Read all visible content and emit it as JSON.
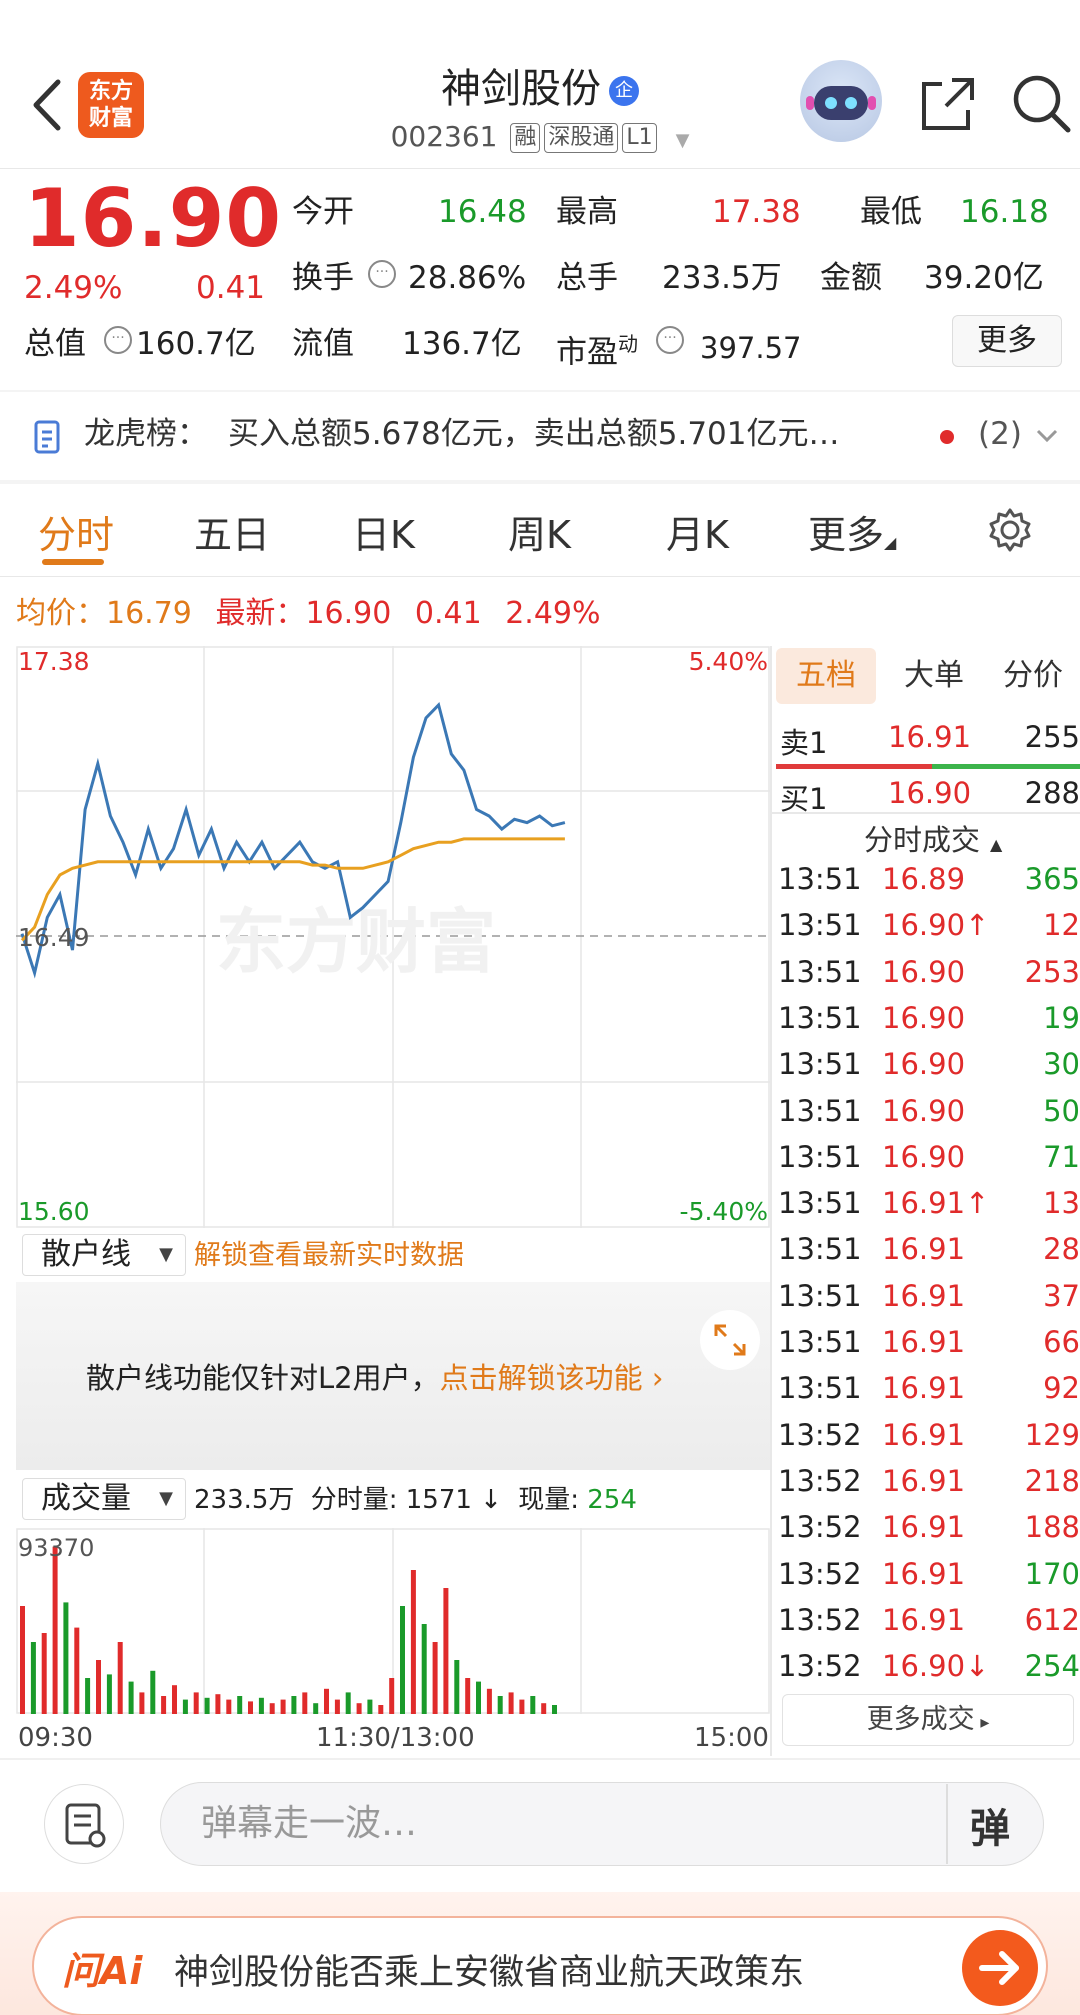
{
  "header": {
    "logo_text": "东方\n财富",
    "logo_l1": "东方",
    "logo_l2": "财富",
    "title": "神剑股份",
    "title_badge": "企",
    "code": "002361",
    "tags": [
      "融",
      "深股通",
      "L1"
    ]
  },
  "quote": {
    "price": "16.90",
    "change_pct": "2.49%",
    "change": "0.41",
    "open_label": "今开",
    "open": "16.48",
    "high_label": "最高",
    "high": "17.38",
    "low_label": "最低",
    "low": "16.18",
    "turnover_label": "换手",
    "turnover": "28.86%",
    "vol_label": "总手",
    "vol": "233.5万",
    "amount_label": "金额",
    "amount": "39.20亿",
    "mcap_label": "总值",
    "mcap": "160.7亿",
    "float_label": "流值",
    "float": "136.7亿",
    "pe_label": "市盈",
    "pe_sup": "动",
    "pe": "397.57",
    "more_label": "更多"
  },
  "lhb": {
    "label": "龙虎榜：",
    "text": "买入总额5.678亿元，卖出总额5.701亿元…",
    "count": "(2)"
  },
  "tabs": [
    "分时",
    "五日",
    "日K",
    "周K",
    "月K",
    "更多"
  ],
  "avg": {
    "avg_label": "均价：",
    "avg": "16.79",
    "latest_label": "最新：",
    "latest": "16.90",
    "chg": "0.41",
    "pct": "2.49%"
  },
  "chart_data": {
    "type": "line",
    "y_top_label": "17.38",
    "y_base_label": "16.49",
    "y_bottom_label": "15.60",
    "pct_top_label": "5.40%",
    "pct_bottom_label": "-5.40%",
    "ylim": [
      15.6,
      17.38
    ],
    "base": 16.49,
    "x_tick_labels": [
      "09:30",
      "11:30/13:00",
      "15:00"
    ],
    "watermark": "东方财富",
    "series": [
      {
        "values": [
          16.5,
          16.38,
          16.55,
          16.62,
          16.45,
          16.88,
          17.02,
          16.86,
          16.78,
          16.68,
          16.82,
          16.7,
          16.76,
          16.88,
          16.74,
          16.82,
          16.7,
          16.78,
          16.72,
          16.78,
          16.7,
          16.74,
          16.78,
          16.72,
          16.7,
          16.72,
          16.55,
          16.58,
          16.62,
          16.66,
          16.84,
          17.04,
          17.16,
          17.2,
          17.05,
          17.0,
          16.88,
          16.86,
          16.82,
          16.85,
          16.84,
          16.86,
          16.83,
          16.84
        ]
      },
      {
        "values": [
          16.48,
          16.52,
          16.62,
          16.68,
          16.7,
          16.71,
          16.72,
          16.72,
          16.72,
          16.72,
          16.72,
          16.72,
          16.72,
          16.72,
          16.72,
          16.72,
          16.72,
          16.72,
          16.72,
          16.72,
          16.72,
          16.72,
          16.72,
          16.71,
          16.71,
          16.7,
          16.7,
          16.7,
          16.71,
          16.72,
          16.74,
          16.76,
          16.77,
          16.78,
          16.78,
          16.79,
          16.79,
          16.79,
          16.79,
          16.79,
          16.79,
          16.79,
          16.79,
          16.79
        ]
      }
    ],
    "volume": {
      "max_label": "93370",
      "max": 93370,
      "values": [
        60,
        40,
        45,
        93,
        62,
        48,
        20,
        30,
        22,
        40,
        18,
        12,
        24,
        10,
        16,
        8,
        12,
        9,
        11,
        8,
        10,
        7,
        9,
        6,
        8,
        10,
        12,
        6,
        14,
        8,
        12,
        6,
        8,
        5,
        20,
        60,
        80,
        50,
        40,
        70,
        30,
        20,
        18,
        14,
        10,
        12,
        8,
        10,
        6,
        5
      ],
      "up": [
        1,
        0,
        1,
        1,
        0,
        1,
        0,
        1,
        0,
        1,
        0,
        1,
        0,
        1,
        1,
        0,
        1,
        0,
        1,
        1,
        0,
        1,
        0,
        1,
        1,
        0,
        1,
        0,
        1,
        1,
        0,
        1,
        0,
        1,
        1,
        0,
        1,
        0,
        1,
        1,
        0,
        1,
        0,
        1,
        0,
        1,
        1,
        0,
        1,
        0
      ]
    }
  },
  "orderbook": {
    "tabs": [
      "五档",
      "大单",
      "分价"
    ],
    "sell1": {
      "label": "卖1",
      "price": "16.91",
      "vol": "255"
    },
    "buy1": {
      "label": "买1",
      "price": "16.90",
      "vol": "288"
    },
    "ticks_title": "分时成交",
    "ticks": [
      {
        "t": "13:51",
        "p": "16.89",
        "v": "365",
        "vc": "green"
      },
      {
        "t": "13:51",
        "p": "16.90↑",
        "v": "12",
        "vc": "red"
      },
      {
        "t": "13:51",
        "p": "16.90",
        "v": "253",
        "vc": "red"
      },
      {
        "t": "13:51",
        "p": "16.90",
        "v": "19",
        "vc": "green"
      },
      {
        "t": "13:51",
        "p": "16.90",
        "v": "30",
        "vc": "green"
      },
      {
        "t": "13:51",
        "p": "16.90",
        "v": "50",
        "vc": "green"
      },
      {
        "t": "13:51",
        "p": "16.90",
        "v": "71",
        "vc": "green"
      },
      {
        "t": "13:51",
        "p": "16.91↑",
        "v": "13",
        "vc": "red"
      },
      {
        "t": "13:51",
        "p": "16.91",
        "v": "28",
        "vc": "red"
      },
      {
        "t": "13:51",
        "p": "16.91",
        "v": "37",
        "vc": "red"
      },
      {
        "t": "13:51",
        "p": "16.91",
        "v": "66",
        "vc": "red"
      },
      {
        "t": "13:51",
        "p": "16.91",
        "v": "92",
        "vc": "red"
      },
      {
        "t": "13:52",
        "p": "16.91",
        "v": "129",
        "vc": "red"
      },
      {
        "t": "13:52",
        "p": "16.91",
        "v": "218",
        "vc": "red"
      },
      {
        "t": "13:52",
        "p": "16.91",
        "v": "188",
        "vc": "red"
      },
      {
        "t": "13:52",
        "p": "16.91",
        "v": "170",
        "vc": "green"
      },
      {
        "t": "13:52",
        "p": "16.91",
        "v": "612",
        "vc": "red"
      },
      {
        "t": "13:52",
        "p": "16.90↓",
        "v": "254",
        "vc": "green"
      }
    ],
    "more_ticks": "更多成交"
  },
  "retail": {
    "select": "散户线",
    "unlock_link": "解锁查看最新实时数据",
    "notice": "散户线功能仅针对L2用户，",
    "notice_link": "点击解锁该功能"
  },
  "volume_bar": {
    "select": "成交量",
    "total": "233.5万",
    "min_label": "分时量:",
    "min_val": "1571",
    "now_label": "现量:",
    "now_val": "254"
  },
  "chat": {
    "placeholder": "弹幕走一波…",
    "send": "弹"
  },
  "ai": {
    "brand": "问Ai",
    "question": "神剑股份能否乘上安徽省商业航天政策东"
  },
  "colors": {
    "up": "#e02b2b",
    "down": "#1a9a2a",
    "price_line": "#3b78b5",
    "avg_line": "#e8a020",
    "accent": "#e07a1a"
  }
}
